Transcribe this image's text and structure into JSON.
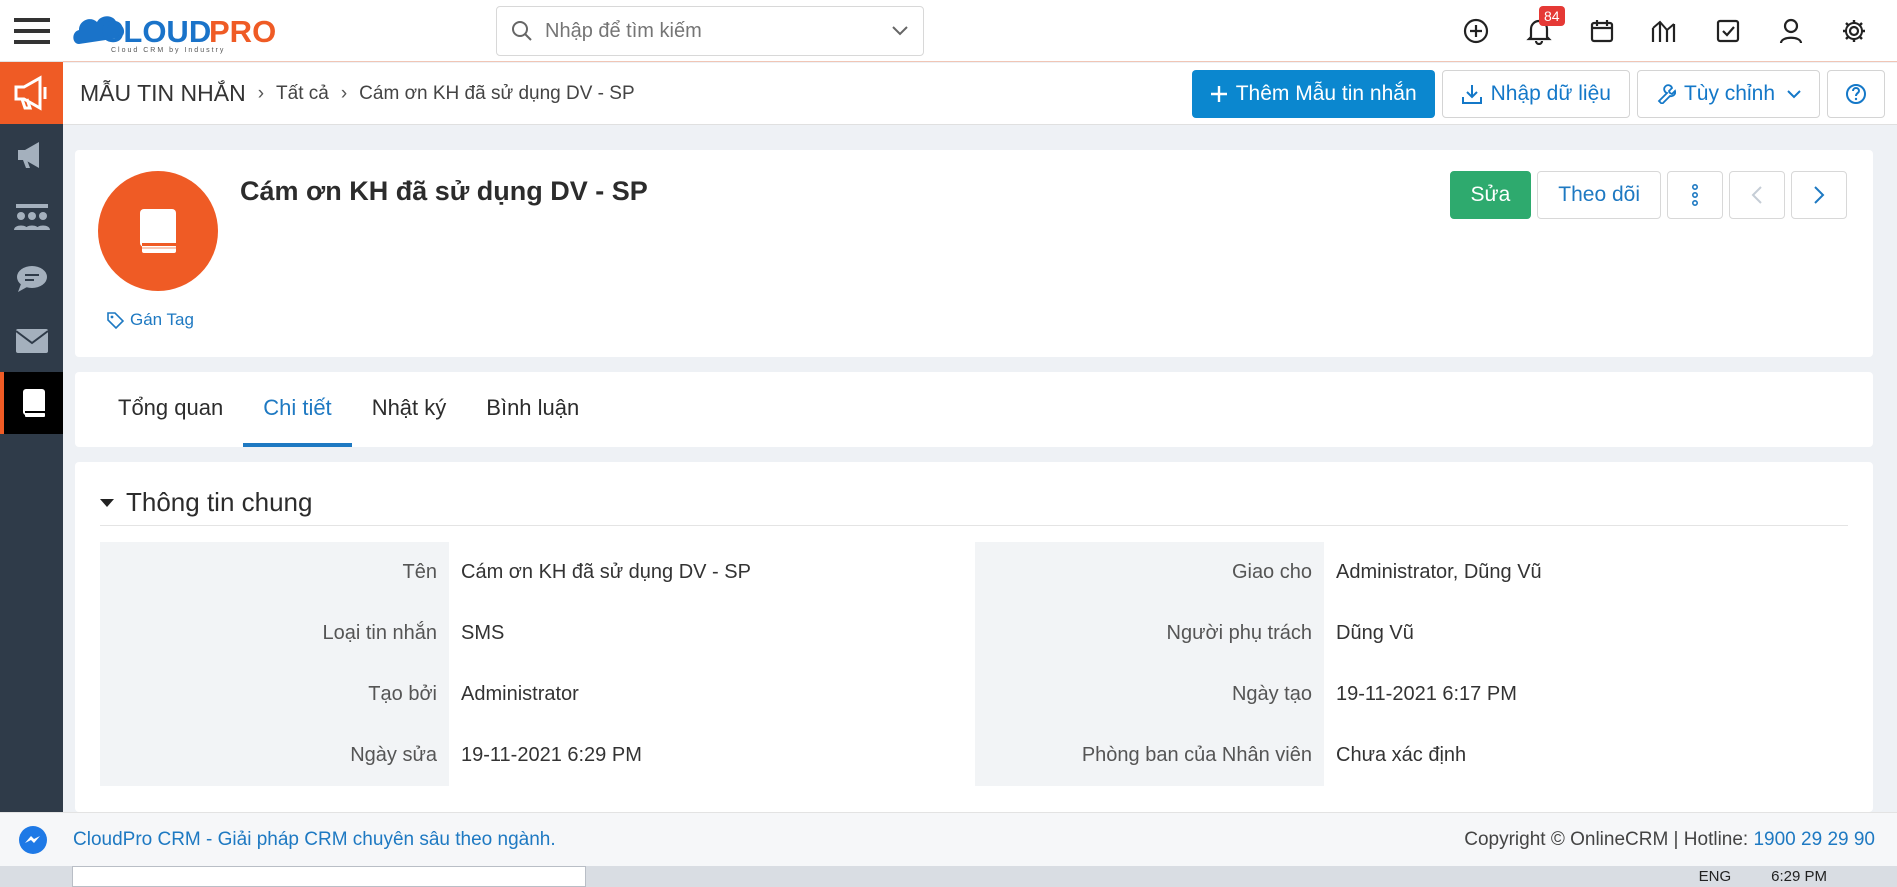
{
  "brand": {
    "logo_text": "CLOUDPRO",
    "logo_tagline": "Cloud CRM by Industry",
    "accent": "#ef5b25",
    "primary": "#0b87cf"
  },
  "search": {
    "placeholder": "Nhập để tìm kiếm"
  },
  "topbar": {
    "notification_count": "84",
    "icons": [
      "add-circle-icon",
      "bell-icon",
      "calendar-icon",
      "chart-icon",
      "checkbox-icon",
      "user-icon",
      "gear-icon"
    ]
  },
  "sidebar": {
    "items": [
      "megaphone-icon",
      "megaphone-icon",
      "team-icon",
      "chat-icon",
      "mail-icon",
      "book-icon"
    ]
  },
  "breadcrumb": {
    "module": "MẪU TIN NHẮN",
    "level1": "Tất cả",
    "current": "Cám ơn KH đã sử dụng DV - SP"
  },
  "actions": {
    "add_label": "Thêm Mẫu tin nhắn",
    "import_label": "Nhập dữ liệu",
    "customize_label": "Tùy chỉnh"
  },
  "record": {
    "title": "Cám ơn KH đã sử dụng DV - SP",
    "tag_label": "Gán Tag",
    "edit_label": "Sửa",
    "follow_label": "Theo dõi"
  },
  "tabs": [
    {
      "label": "Tổng quan"
    },
    {
      "label": "Chi tiết"
    },
    {
      "label": "Nhật ký"
    },
    {
      "label": "Bình luận"
    }
  ],
  "section": {
    "title": "Thông tin chung",
    "left": [
      {
        "label": "Tên",
        "value": "Cám ơn KH đã sử dụng DV - SP"
      },
      {
        "label": "Loại tin nhắn",
        "value": "SMS"
      },
      {
        "label": "Tạo bởi",
        "value": "Administrator"
      },
      {
        "label": "Ngày sửa",
        "value": "19-11-2021 6:29 PM"
      }
    ],
    "right": [
      {
        "label": "Giao cho",
        "value": "Administrator, Dũng Vũ"
      },
      {
        "label": "Người phụ trách",
        "value": "Dũng Vũ"
      },
      {
        "label": "Ngày tạo",
        "value": "19-11-2021 6:17 PM"
      },
      {
        "label": "Phòng ban của Nhân viên",
        "value": "Chưa xác định"
      }
    ]
  },
  "footer": {
    "left_text": "CloudPro CRM - Giải pháp CRM chuyên sâu theo ngành.",
    "copyright": "Copyright © OnlineCRM | Hotline: ",
    "hotline": "1900 29 29 90"
  },
  "taskbar": {
    "lang": "ENG",
    "time": "6:29 PM"
  }
}
